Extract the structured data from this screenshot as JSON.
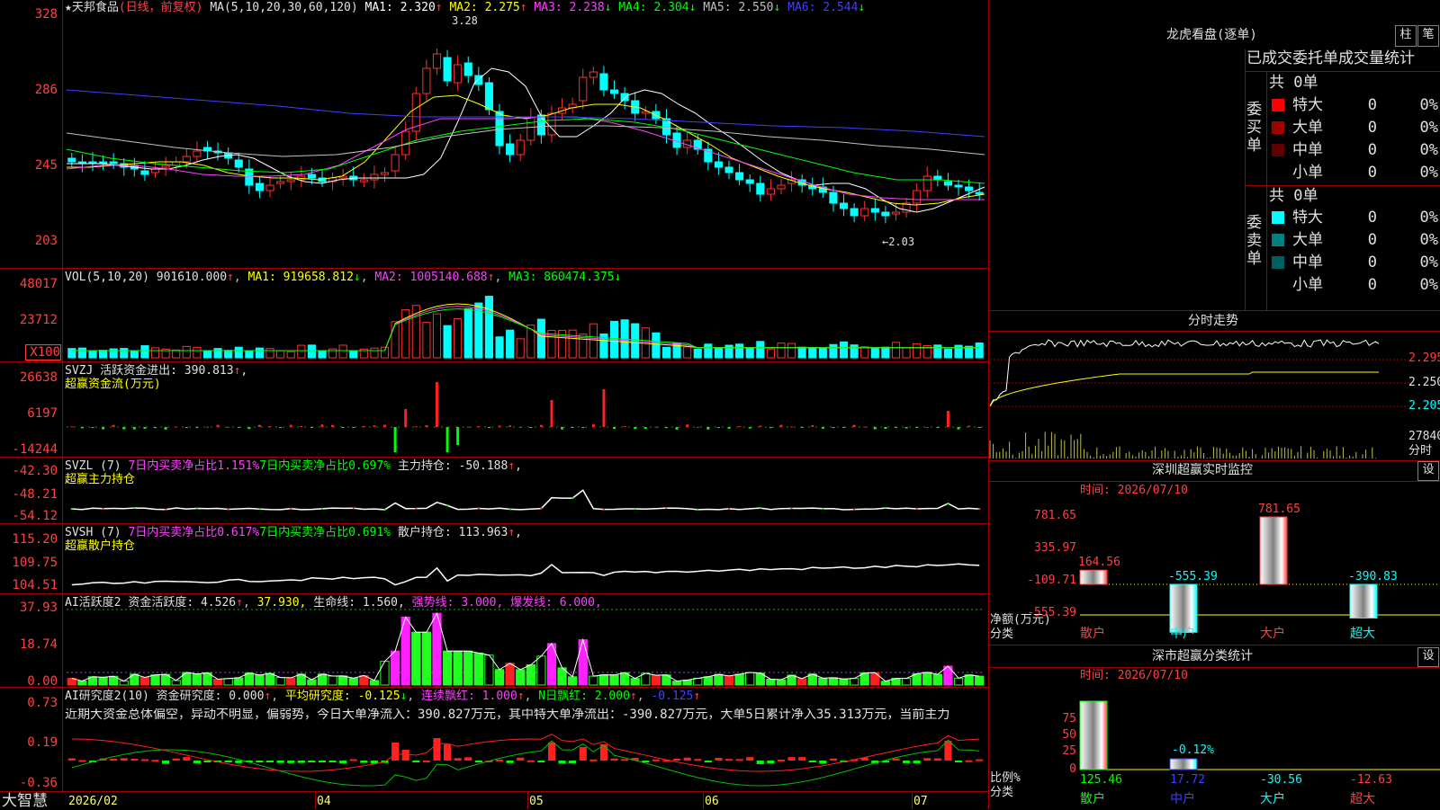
{
  "header": {
    "stock_title": "★天邦食品",
    "period": "(日线，前复权)",
    "ma_params": "MA(5,10,20,30,60,120)",
    "ma": [
      {
        "label": "MA1:",
        "value": "2.320",
        "arrow": "↑",
        "color": "#ffffff"
      },
      {
        "label": "MA2:",
        "value": "2.275",
        "arrow": "↑",
        "color": "#ffff00"
      },
      {
        "label": "MA3:",
        "value": "2.238",
        "arrow": "↓",
        "color": "#ff40ff"
      },
      {
        "label": "MA4:",
        "value": "2.304",
        "arrow": "↓",
        "color": "#00ff00"
      },
      {
        "label": "MA5:",
        "value": "2.550",
        "arrow": "↓",
        "color": "#c0c0c0"
      },
      {
        "label": "MA6:",
        "value": "2.544",
        "arrow": "↓",
        "color": "#4040ff"
      }
    ],
    "hi_label": "3.28",
    "lo_label": "←2.03"
  },
  "axes": {
    "price": [
      "328",
      "286",
      "245",
      "203"
    ],
    "vol": [
      "48017",
      "23712",
      "X100"
    ],
    "svzj": [
      "26638",
      "6197",
      "-14244"
    ],
    "svzl": [
      "-42.30",
      "-48.21",
      "-54.12"
    ],
    "svsh": [
      "115.20",
      "109.75",
      "104.51"
    ],
    "ai1": [
      "37.93",
      "18.74",
      "0.00"
    ],
    "ai2": [
      "0.73",
      "0.19",
      "-0.36"
    ]
  },
  "dates": {
    "d1": "2026/02",
    "d2": "04",
    "d3": "05",
    "d4": "06",
    "d5": "07"
  },
  "logo": "大智慧",
  "vol_title": {
    "name": "VOL(5,10,20)",
    "value": "901610.000",
    "arrow": "↑",
    "ma1": "MA1: 919658.812",
    "ma1a": "↓",
    "ma2": "MA2: 1005140.688",
    "ma2a": "↑",
    "ma3": "MA3: 860474.375",
    "ma3a": "↓"
  },
  "svzj_title": {
    "name": "SVZJ",
    "label": "活跃资金进出: 390.813",
    "arrow": "↑",
    "tail": ",",
    "sub": "超赢资金流(万元)"
  },
  "svzl_title": {
    "name": "SVZL (7)",
    "a": "7日内买卖净占比1.151%",
    "b": "7日内买卖净占比0.697%",
    "c": "主力持仓: -50.188",
    "arrow": "↑",
    "tail": ",",
    "sub": "超赢主力持仓"
  },
  "svsh_title": {
    "name": "SVSH (7)",
    "a": "7日内买卖净占比0.617%",
    "b": "7日内买卖净占比0.691%",
    "c": "散户持仓: 113.963",
    "arrow": "↑",
    "tail": ",",
    "sub": "超赢散户持仓"
  },
  "ai1_title": {
    "name": "AI活跃度2",
    "a": "资金活跃度: 4.526",
    "aa": "↑",
    "b": "37.930,",
    "c": "生命线: 1.560,",
    "d": "强势线: 3.000,",
    "e": "爆发线: 6.000,"
  },
  "ai2_title": {
    "name": "AI研究度2(10)",
    "a": "资金研究度: 0.000",
    "aa": "↑",
    "b": "平均研究度: -0.125",
    "ba": "↓",
    "c": "连续飘红: 1.000",
    "ca": "↑",
    "d": "N日飘红: 2.000",
    "da": "↑",
    "e": "-0.125",
    "ea": "↑",
    "text": "近期大资金总体偏空，异动不明显，偏弱势，今日大单净流入：390.827万元，其中特大单净流出：-390.827万元，大单5日累计净入35.313万元，当前主力"
  },
  "lhb": {
    "title": "龙虎看盘(逐单)",
    "btn1": "柱",
    "btn2": "笔",
    "head": "已成交委托单成交量统计",
    "buy_label": "委买单",
    "sell_label": "委卖单",
    "buy_total": "共 0单",
    "sell_total": "共 0单",
    "rows_buy": [
      {
        "name": "特大",
        "n": "0",
        "p": "0%",
        "c": "#ff0000"
      },
      {
        "name": "大单",
        "n": "0",
        "p": "0%",
        "c": "#a00000"
      },
      {
        "name": "中单",
        "n": "0",
        "p": "0%",
        "c": "#600000"
      },
      {
        "name": "小单",
        "n": "0",
        "p": "0%",
        "c": "#000000"
      }
    ],
    "rows_sell": [
      {
        "name": "特大",
        "n": "0",
        "p": "0%",
        "c": "#00ffff"
      },
      {
        "name": "大单",
        "n": "0",
        "p": "0%",
        "c": "#008080"
      },
      {
        "name": "中单",
        "n": "0",
        "p": "0%",
        "c": "#006060"
      },
      {
        "name": "小单",
        "n": "0",
        "p": "0%",
        "c": "#000000"
      }
    ]
  },
  "fenshi": {
    "title": "分时走势",
    "p1": "2.295",
    "p2": "2.250",
    "p3": "2.205",
    "v1": "27840",
    "v2": "分时"
  },
  "sz_monitor": {
    "title": "深圳超赢实时监控",
    "btn": "设",
    "time": "时间: 2026/07/10",
    "yaxis": [
      "781.65",
      "335.97",
      "-109.71",
      "-555.39"
    ],
    "ylabel1": "净额(万元)",
    "ylabel2": "分类",
    "bars": [
      {
        "cat": "散户",
        "value": "164.56",
        "color": "#ff4040"
      },
      {
        "cat": "中户",
        "value": "-555.39",
        "color": "#00ffff"
      },
      {
        "cat": "大户",
        "value": "781.65",
        "color": "#ff4040"
      },
      {
        "cat": "超大",
        "value": "-390.83",
        "color": "#00ffff"
      }
    ]
  },
  "sz_class": {
    "title": "深市超赢分类统计",
    "btn": "设",
    "time": "时间: 2026/07/10",
    "yaxis": [
      "75",
      "50",
      "25",
      "0"
    ],
    "ylabel1": "比例%",
    "ylabel2": "分类",
    "bar_label": "-0.12%",
    "cats": [
      {
        "cat": "散户",
        "value": "125.46",
        "color": "#00ff00"
      },
      {
        "cat": "中户",
        "value": "17.72",
        "color": "#4040ff"
      },
      {
        "cat": "大户",
        "value": "-30.56",
        "color": "#00ffff"
      },
      {
        "cat": "超大",
        "value": "-12.63",
        "color": "#ff4040"
      }
    ]
  },
  "chart_data": [
    {
      "type": "candlestick",
      "name": "price",
      "ylim": [
        2.03,
        3.28
      ],
      "ticks": [
        3.28,
        2.86,
        2.45,
        2.03
      ],
      "close": [
        2.48,
        2.47,
        2.47,
        2.47,
        2.47,
        2.45,
        2.44,
        2.41,
        2.44,
        2.46,
        2.48,
        2.51,
        2.54,
        2.54,
        2.53,
        2.5,
        2.45,
        2.35,
        2.32,
        2.35,
        2.37,
        2.38,
        2.4,
        2.39,
        2.37,
        2.39,
        2.4,
        2.38,
        2.38,
        2.41,
        2.42,
        2.52,
        2.65,
        2.86,
        3.0,
        3.08,
        2.93,
        3.02,
        2.96,
        2.91,
        2.77,
        2.57,
        2.52,
        2.6,
        2.73,
        2.63,
        2.75,
        2.78,
        2.8,
        2.95,
        2.98,
        2.88,
        2.86,
        2.82,
        2.75,
        2.76,
        2.72,
        2.63,
        2.56,
        2.6,
        2.55,
        2.48,
        2.45,
        2.42,
        2.38,
        2.36,
        2.3,
        2.33,
        2.35,
        2.38,
        2.35,
        2.33,
        2.31,
        2.25,
        2.22,
        2.18,
        2.22,
        2.2,
        2.18,
        2.2,
        2.25,
        2.32,
        2.4,
        2.38,
        2.35,
        2.34,
        2.32,
        2.3
      ],
      "open": [
        2.5,
        2.48,
        2.48,
        2.48,
        2.48,
        2.47,
        2.46,
        2.43,
        2.42,
        2.45,
        2.46,
        2.48,
        2.51,
        2.56,
        2.54,
        2.53,
        2.49,
        2.44,
        2.36,
        2.32,
        2.36,
        2.37,
        2.38,
        2.41,
        2.39,
        2.37,
        2.39,
        2.4,
        2.37,
        2.38,
        2.41,
        2.43,
        2.52,
        2.65,
        2.86,
        3.0,
        3.06,
        2.92,
        3.03,
        2.96,
        2.92,
        2.76,
        2.58,
        2.52,
        2.6,
        2.74,
        2.63,
        2.75,
        2.78,
        2.82,
        2.95,
        2.97,
        2.88,
        2.86,
        2.82,
        2.75,
        2.76,
        2.72,
        2.64,
        2.56,
        2.6,
        2.55,
        2.48,
        2.45,
        2.42,
        2.38,
        2.36,
        2.3,
        2.33,
        2.36,
        2.38,
        2.35,
        2.34,
        2.31,
        2.25,
        2.22,
        2.18,
        2.22,
        2.2,
        2.19,
        2.2,
        2.25,
        2.32,
        2.4,
        2.37,
        2.35,
        2.34,
        2.31
      ],
      "ma": [
        {
          "c": "#ffffff",
          "v": [
            2.47,
            2.47,
            2.47,
            2.46,
            2.45,
            2.44,
            2.44,
            2.46,
            2.49,
            2.51,
            2.52,
            2.5,
            2.45,
            2.4,
            2.37,
            2.36,
            2.38,
            2.39,
            2.39,
            2.39,
            2.39,
            2.41,
            2.5,
            2.7,
            2.92,
            3.0,
            2.98,
            2.9,
            2.72,
            2.62,
            2.62,
            2.68,
            2.75,
            2.85,
            2.88,
            2.86,
            2.8,
            2.75,
            2.68,
            2.62,
            2.55,
            2.48,
            2.42,
            2.38,
            2.35,
            2.36,
            2.36,
            2.33,
            2.27,
            2.22,
            2.2,
            2.22,
            2.26,
            2.3,
            2.34
          ]
        },
        {
          "c": "#ffff00",
          "v": [
            2.45,
            2.45,
            2.46,
            2.47,
            2.48,
            2.48,
            2.46,
            2.42,
            2.4,
            2.39,
            2.39,
            2.38,
            2.4,
            2.48,
            2.62,
            2.76,
            2.84,
            2.85,
            2.8,
            2.74,
            2.72,
            2.74,
            2.78,
            2.8,
            2.8,
            2.78,
            2.72,
            2.65,
            2.58,
            2.5,
            2.45,
            2.4,
            2.36,
            2.33,
            2.31,
            2.28,
            2.25,
            2.24,
            2.25,
            2.28,
            2.3
          ]
        },
        {
          "c": "#ff40ff",
          "v": [
            2.44,
            2.46,
            2.46,
            2.44,
            2.41,
            2.4,
            2.4,
            2.41,
            2.46,
            2.56,
            2.66,
            2.72,
            2.72,
            2.72,
            2.73,
            2.73,
            2.7,
            2.65,
            2.59,
            2.53,
            2.47,
            2.41,
            2.35,
            2.3,
            2.28,
            2.27,
            2.27,
            2.27
          ]
        },
        {
          "c": "#00ff00",
          "v": [
            2.55,
            2.5,
            2.47,
            2.45,
            2.43,
            2.42,
            2.44,
            2.52,
            2.6,
            2.65,
            2.68,
            2.71,
            2.72,
            2.7,
            2.66,
            2.6,
            2.54,
            2.48,
            2.42,
            2.38,
            2.38,
            2.36
          ]
        },
        {
          "c": "#c0c0c0",
          "v": [
            2.64,
            2.6,
            2.56,
            2.53,
            2.51,
            2.52,
            2.56,
            2.62,
            2.66,
            2.68,
            2.68,
            2.67,
            2.65,
            2.62,
            2.6,
            2.57,
            2.55,
            2.52
          ]
        },
        {
          "c": "#4040ff",
          "v": [
            2.88,
            2.85,
            2.82,
            2.79,
            2.75,
            2.73,
            2.73,
            2.73,
            2.72,
            2.7,
            2.68,
            2.67,
            2.65,
            2.62
          ]
        }
      ]
    },
    {
      "type": "bar",
      "name": "volume",
      "ylim": [
        0,
        48017
      ],
      "unit": "X100"
    },
    {
      "type": "bar",
      "name": "svzj",
      "ylim": [
        -14244,
        26638
      ]
    },
    {
      "type": "line",
      "name": "svzl",
      "ylim": [
        -54.12,
        -42.3
      ]
    },
    {
      "type": "line",
      "name": "svsh",
      "ylim": [
        104.51,
        115.2
      ]
    },
    {
      "type": "bar",
      "name": "ai1",
      "ylim": [
        0,
        37.93
      ],
      "lines": {
        "life": 1.56,
        "strong": 3.0,
        "burst": 6.0
      }
    },
    {
      "type": "bar",
      "name": "ai2",
      "ylim": [
        -0.36,
        0.73
      ]
    },
    {
      "type": "bar",
      "name": "sz_monitor",
      "categories": [
        "散户",
        "中户",
        "大户",
        "超大"
      ],
      "values": [
        164.56,
        -555.39,
        781.65,
        -390.83
      ],
      "ylim": [
        -555.39,
        781.65
      ]
    },
    {
      "type": "bar",
      "name": "sz_class",
      "categories": [
        "散户",
        "中户",
        "大户",
        "超大"
      ],
      "values": [
        125.46,
        17.72,
        -30.56,
        -12.63
      ],
      "ylim": [
        0,
        75
      ]
    }
  ]
}
